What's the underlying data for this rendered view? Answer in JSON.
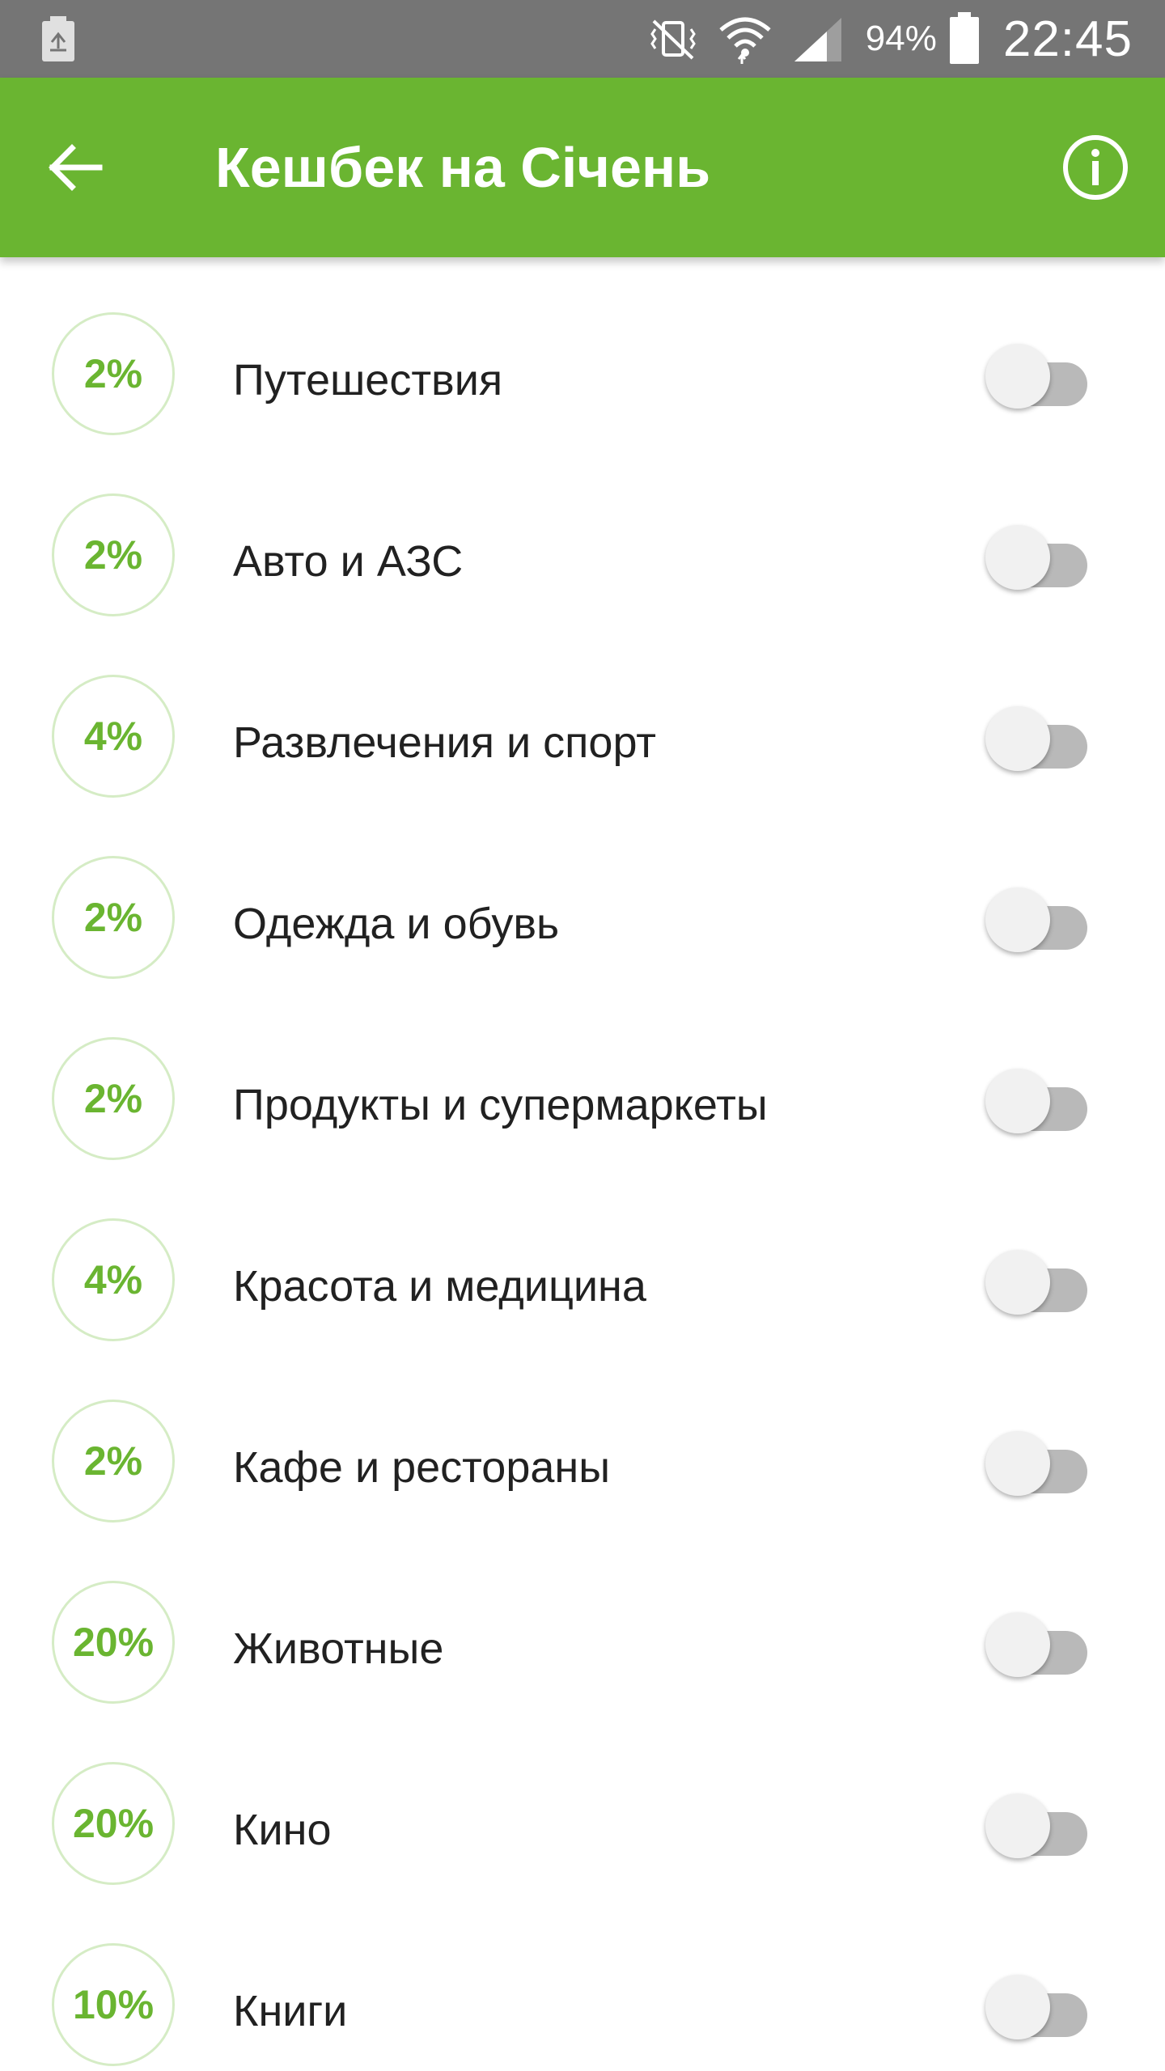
{
  "status_bar": {
    "battery_percent": "94%",
    "time": "22:45",
    "icons": [
      "battery-saver-icon",
      "vibrate-mute-icon",
      "wifi-icon",
      "signal-icon",
      "battery-icon"
    ]
  },
  "app_bar": {
    "title": "Кешбек на Січень",
    "back_icon": "arrow-left-icon",
    "info_icon": "info-icon"
  },
  "colors": {
    "accent": "#6ab531",
    "status_bar": "#757575",
    "badge_border": "#d5ecc5",
    "toggle_track_off": "#b9b9b9",
    "toggle_thumb_off": "#f1f1f1",
    "text": "#212121"
  },
  "categories": [
    {
      "percent": "2%",
      "label": "Путешествия",
      "enabled": false
    },
    {
      "percent": "2%",
      "label": "Авто и АЗС",
      "enabled": false
    },
    {
      "percent": "4%",
      "label": "Развлечения и спорт",
      "enabled": false
    },
    {
      "percent": "2%",
      "label": "Одежда и обувь",
      "enabled": false
    },
    {
      "percent": "2%",
      "label": "Продукты и супермаркеты",
      "enabled": false
    },
    {
      "percent": "4%",
      "label": "Красота и медицина",
      "enabled": false
    },
    {
      "percent": "2%",
      "label": "Кафе и рестораны",
      "enabled": false
    },
    {
      "percent": "20%",
      "label": "Животные",
      "enabled": false
    },
    {
      "percent": "20%",
      "label": "Кино",
      "enabled": false
    },
    {
      "percent": "10%",
      "label": "Книги",
      "enabled": false
    }
  ]
}
